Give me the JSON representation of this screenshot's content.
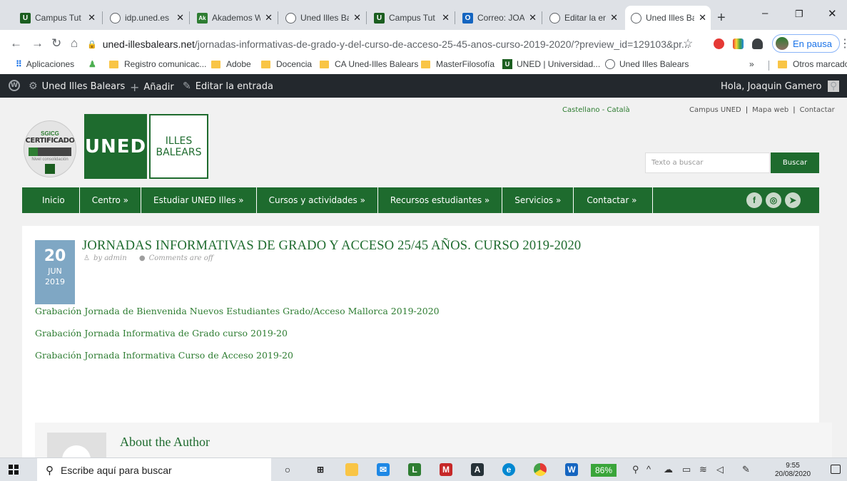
{
  "browser": {
    "tabs": [
      {
        "title": "Campus Tut",
        "icon": "uned-favicon"
      },
      {
        "title": "idp.uned.es",
        "icon": "globe-favicon"
      },
      {
        "title": "Akademos W",
        "icon": "akademos-favicon"
      },
      {
        "title": "Uned Illes Ba",
        "icon": "globe-favicon"
      },
      {
        "title": "Campus Tut",
        "icon": "uned-favicon"
      },
      {
        "title": "Correo: JOA",
        "icon": "outlook-favicon"
      },
      {
        "title": "Editar la ent",
        "icon": "globe-favicon"
      },
      {
        "title": "Uned Illes Ba",
        "icon": "globe-favicon",
        "active": true
      }
    ],
    "tab_close": "✕",
    "new_tab": "+",
    "url_host": "uned-illesbalears.net",
    "url_path": "/jornadas-informativas-de-grado-y-del-curso-de-acceso-25-45-anos-curso-2019-2020/?preview_id=129103&pr...",
    "profile_label": "En pausa",
    "bookmarks": [
      {
        "label": "Aplicaciones",
        "icon": "apps-grid-icon"
      },
      {
        "label": "",
        "icon": "extension-icon"
      },
      {
        "label": "Registro comunicac...",
        "icon": "folder-icon"
      },
      {
        "label": "Adobe",
        "icon": "folder-icon"
      },
      {
        "label": "Docencia",
        "icon": "folder-icon"
      },
      {
        "label": "CA Uned-Illes Balears",
        "icon": "folder-icon"
      },
      {
        "label": "MasterFilosofía",
        "icon": "folder-icon"
      },
      {
        "label": "UNED | Universidad...",
        "icon": "uned-favicon"
      },
      {
        "label": "Uned Illes Balears",
        "icon": "globe-favicon"
      }
    ],
    "bookmarks_more": "»",
    "other_bookmarks": "Otros marcadores"
  },
  "adminbar": {
    "site_name": "Uned Illes Balears",
    "add_new": "Añadir",
    "edit_post": "Editar la entrada",
    "greeting": "Hola, Joaquin Gamero"
  },
  "site": {
    "lang_links": "Castellano - Català",
    "top_links": [
      "Campus UNED",
      "Mapa web",
      "Contactar"
    ],
    "top_links_sep": "|",
    "cert_line1": "SGICG",
    "cert_line2": "CERTIFICADO",
    "cert_line3": "Nivel consolidación",
    "logo_uned": "UNED",
    "logo_illes_1": "ILLES",
    "logo_illes_2": "BALEARS",
    "search_placeholder": "Texto a buscar",
    "search_button": "Buscar",
    "nav": [
      "Inicio",
      "Centro »",
      "Estudiar UNED Illes »",
      "Cursos y actividades »",
      "Recursos estudiantes »",
      "Servicios »",
      "Contactar »"
    ],
    "social": [
      "facebook-icon",
      "instagram-icon",
      "twitter-icon"
    ]
  },
  "post": {
    "day": "20",
    "month": "JUN",
    "year": "2019",
    "title": "JORNADAS INFORMATIVAS DE GRADO Y ACCESO 25/45 AÑOS. CURSO 2019-2020",
    "author": "by admin",
    "comments": "Comments are off",
    "links": [
      "Grabación Jornada de Bienvenida Nuevos Estudiantes Grado/Acceso Mallorca 2019-2020",
      "Grabación Jornada Informativa de Grado curso 2019-20",
      "Grabación Jornada Informativa Curso de Acceso 2019-20"
    ],
    "about_title": "About the Author"
  },
  "taskbar": {
    "search_placeholder": "Escribe aquí para buscar",
    "battery": "86%",
    "time": "9:55",
    "date": "20/08/2020"
  },
  "colors": {
    "uned_green": "#1e6b2e",
    "date_badge": "#7fa7c4",
    "adminbar": "#23282d"
  }
}
